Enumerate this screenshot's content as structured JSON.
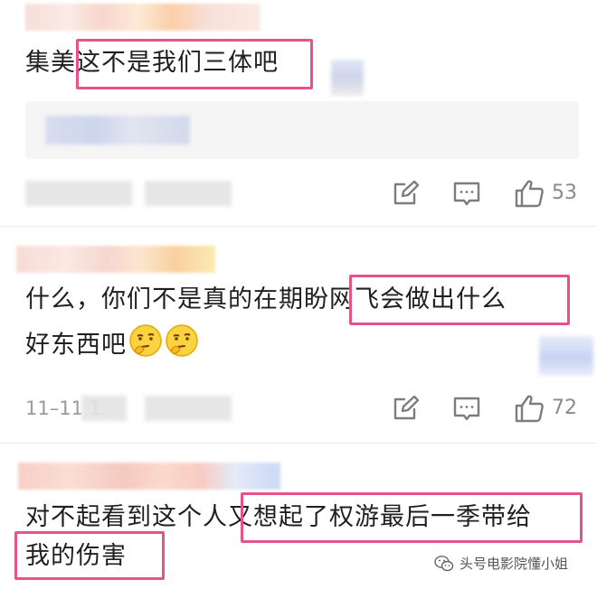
{
  "comments": [
    {
      "text": "集美这不是我们三体吧",
      "likes": "53"
    },
    {
      "text_line1": "什么，你们不是真的在期盼网飞会做出什么",
      "text_line2": "好东西吧",
      "emoji_icons": [
        "thinking-face-icon",
        "thinking-face-icon"
      ],
      "timestamp": "11–11 1",
      "likes": "72"
    },
    {
      "text_line1": "对不起看到这个人又想起了权游最后一季带给",
      "text_line2": "我的伤害"
    }
  ],
  "watermark": {
    "text": "头号电影院懂小姐",
    "icon": "wechat-icon"
  },
  "colors": {
    "highlight": "#e8528c",
    "meta_gray": "#9a9a9a",
    "icon_gray": "#7d7d7d"
  }
}
